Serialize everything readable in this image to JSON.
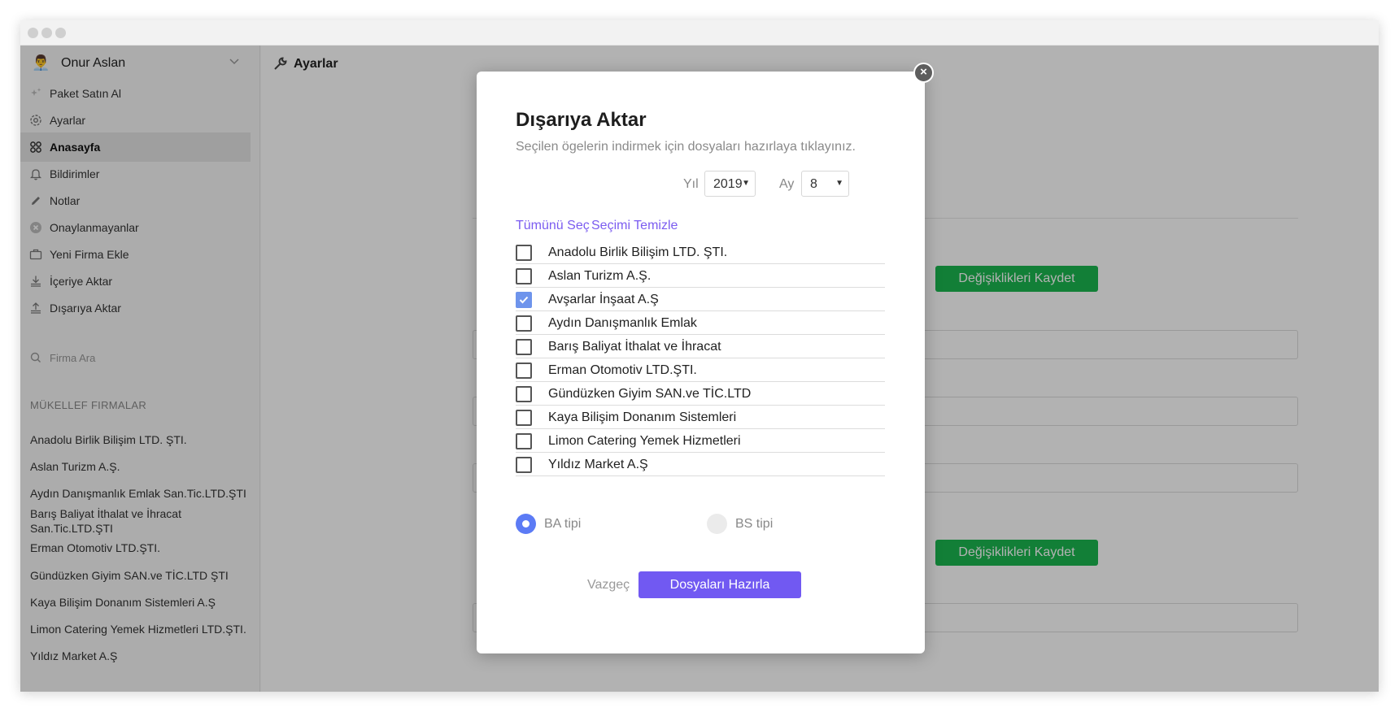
{
  "window": {
    "dots": [
      "close",
      "minimize",
      "maximize"
    ]
  },
  "user": {
    "name": "Onur Aslan",
    "avatar_icon": "person-avatar-icon"
  },
  "sidebar": {
    "items": [
      {
        "label": "Paket Satın Al",
        "icon": "sparkle-icon",
        "active": false
      },
      {
        "label": "Ayarlar",
        "icon": "gear-icon",
        "active": false
      },
      {
        "label": "Anasayfa",
        "icon": "grid-icon",
        "active": true
      },
      {
        "label": "Bildirimler",
        "icon": "bell-icon",
        "active": false
      },
      {
        "label": "Notlar",
        "icon": "pencil-icon",
        "active": false
      },
      {
        "label": "Onaylanmayanlar",
        "icon": "x-circle-icon",
        "active": false
      },
      {
        "label": "Yeni Firma Ekle",
        "icon": "briefcase-icon",
        "active": false
      },
      {
        "label": "İçeriye Aktar",
        "icon": "download-icon",
        "active": false
      },
      {
        "label": "Dışarıya Aktar",
        "icon": "upload-icon",
        "active": false
      }
    ],
    "search_label": "Firma Ara",
    "section_title": "MÜKELLEF FIRMALAR",
    "firms": [
      "Anadolu Birlik Bilişim LTD. ŞTI.",
      "Aslan Turizm A.Ş.",
      "Aydın Danışmanlık Emlak San.Tic.LTD.ŞTI",
      "Barış Baliyat İthalat ve İhracat San.Tic.LTD.ŞTI",
      "Erman Otomotiv LTD.ŞTI.",
      "Gündüzken Giyim SAN.ve TİC.LTD ŞTI",
      "Kaya Bilişim Donanım Sistemleri A.Ş",
      "Limon Catering Yemek Hizmetleri LTD.ŞTI.",
      "Yıldız Market A.Ş"
    ]
  },
  "page": {
    "title": "Ayarlar",
    "save_label_1": "Değişiklikleri Kaydet",
    "save_label_2": "Değişiklikleri Kaydet"
  },
  "modal": {
    "close_label": "×",
    "title": "Dışarıya Aktar",
    "subtitle": "Seçilen ögelerin indirmek için dosyaları hazırlaya tıklayınız.",
    "year_label": "Yıl",
    "year_value": "2019",
    "month_label": "Ay",
    "month_value": "8",
    "select_all": "Tümünü Seç",
    "clear_selection": "Seçimi Temizle",
    "companies": [
      {
        "label": "Anadolu Birlik Bilişim LTD. ŞTI.",
        "checked": false
      },
      {
        "label": "Aslan Turizm A.Ş.",
        "checked": false
      },
      {
        "label": "Avşarlar İnşaat A.Ş",
        "checked": true
      },
      {
        "label": "Aydın Danışmanlık Emlak",
        "checked": false
      },
      {
        "label": "Barış Baliyat İthalat ve İhracat",
        "checked": false
      },
      {
        "label": "Erman Otomotiv LTD.ŞTI.",
        "checked": false
      },
      {
        "label": "Gündüzken Giyim SAN.ve TİC.LTD",
        "checked": false
      },
      {
        "label": "Kaya Bilişim Donanım Sistemleri",
        "checked": false
      },
      {
        "label": "Limon Catering Yemek Hizmetleri",
        "checked": false
      },
      {
        "label": "Yıldız Market A.Ş",
        "checked": false
      }
    ],
    "radio_ba": "BA tipi",
    "radio_bs": "BS tipi",
    "selected_type": "BA tipi",
    "cancel_label": "Vazgeç",
    "primary_label": "Dosyaları Hazırla"
  },
  "colors": {
    "accent": "#7159f2",
    "link": "#7b5cf0",
    "save_green": "#1bb64f",
    "checkbox_checked": "#6e94ec",
    "radio_selected": "#5c7bf5"
  }
}
